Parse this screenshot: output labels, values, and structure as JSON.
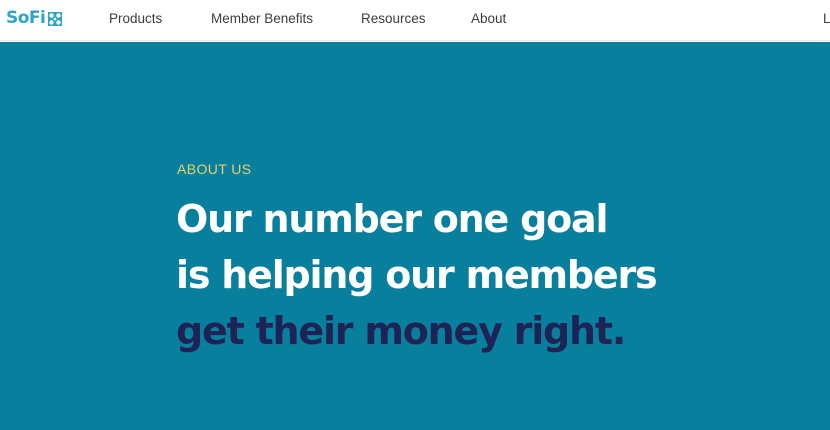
{
  "header": {
    "logo_text": "SoFi",
    "brand_color": "#2ea4c8",
    "nav": {
      "products": "Products",
      "member_benefits": "Member Benefits",
      "resources": "Resources",
      "about": "About",
      "login_partial": "L"
    }
  },
  "hero": {
    "background_color": "#097f9e",
    "eyebrow": "ABOUT US",
    "eyebrow_color": "#e6d16b",
    "headline_line1": "Our number one goal",
    "headline_line2": "is helping our members",
    "headline_line3": "get their money right.",
    "headline_primary_color": "#ffffff",
    "headline_accent_color": "#1d2355"
  }
}
